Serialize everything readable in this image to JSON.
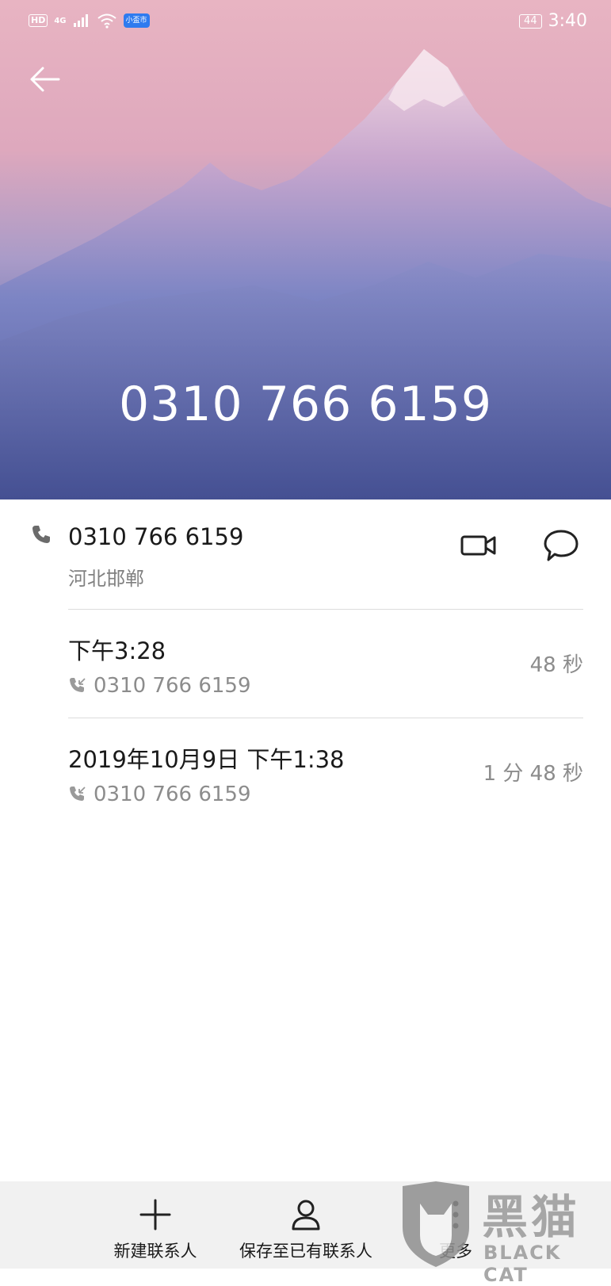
{
  "status_bar": {
    "hd": "HD",
    "network": "4G",
    "app_badge": "小盃市",
    "battery": "44",
    "time": "3:40"
  },
  "header": {
    "title_number": "0310 766 6159"
  },
  "contact": {
    "number": "0310 766 6159",
    "location": "河北邯郸"
  },
  "calls": [
    {
      "time": "下午3:28",
      "number": "0310 766 6159",
      "duration": "48 秒"
    },
    {
      "time": "2019年10月9日 下午1:38",
      "number": "0310 766 6159",
      "duration": "1 分 48 秒"
    }
  ],
  "bottom_bar": {
    "new_contact": "新建联系人",
    "save_existing": "保存至已有联系人",
    "more": "更多"
  },
  "watermark": {
    "main": "黑猫",
    "sub": "BLACK CAT"
  },
  "colors": {
    "header_top": "#e8b4c2",
    "header_bottom": "#4a5598",
    "bottom_bar_bg": "#f1f1f1"
  },
  "icons": [
    "back-arrow-icon",
    "phone-icon",
    "video-call-icon",
    "message-icon",
    "incoming-call-icon",
    "add-icon",
    "person-icon",
    "more-icon",
    "wifi-icon",
    "signal-icon"
  ]
}
